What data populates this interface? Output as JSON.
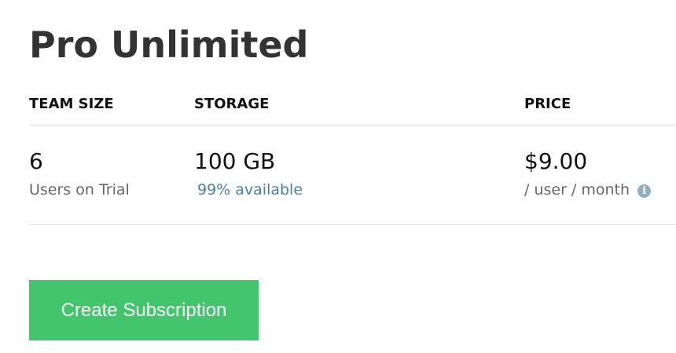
{
  "plan": {
    "title": "Pro Unlimited"
  },
  "columns": {
    "team_size_header": "TEAM SIZE",
    "storage_header": "STORAGE",
    "price_header": "PRICE"
  },
  "team_size": {
    "value": "6",
    "label": "Users on Trial"
  },
  "storage": {
    "value": "100 GB",
    "available": "99% available"
  },
  "price": {
    "value": "$9.00",
    "unit": "/ user / month",
    "info_icon": "info-icon"
  },
  "actions": {
    "create_label": "Create Subscription"
  },
  "colors": {
    "button": "#43c56e",
    "link": "#4a7fa6",
    "info_icon": "#8fb0c4"
  }
}
